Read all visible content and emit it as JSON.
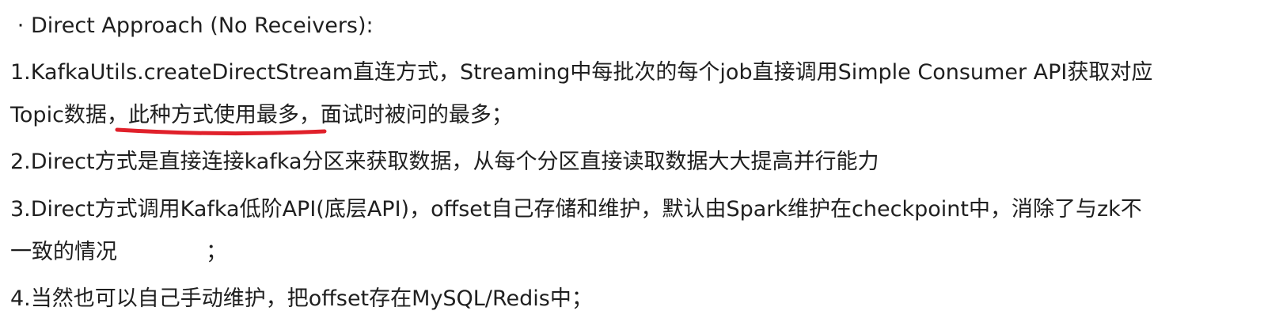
{
  "doc": {
    "heading": {
      "bullet": "·",
      "text": "Direct Approach (No Receivers):"
    },
    "p1": {
      "line1": "1.KafkaUtils.createDirectStream直连方式，Streaming中每批次的每个job直接调用Simple Consumer API获取对应",
      "line2_before": "Topic数据，",
      "line2_highlight": "此种方式使用最多",
      "line2_after": "，面试时被问的最多；"
    },
    "p2": {
      "text": "2.Direct方式是直接连接kafka分区来获取数据，从每个分区直接读取数据大大提高并行能力"
    },
    "p3": {
      "line1": "3.Direct方式调用Kafka低阶API(底层API)，offset自己存储和维护，默认由Spark维护在checkpoint中，消除了与zk不",
      "line2_before": "一致的情况",
      "line2_after": "；"
    },
    "p4": {
      "text": "4.当然也可以自己手动维护，把offset存在MySQL/Redis中；"
    },
    "colors": {
      "text": "#1f1f1f",
      "underline": "#e0202a"
    }
  }
}
